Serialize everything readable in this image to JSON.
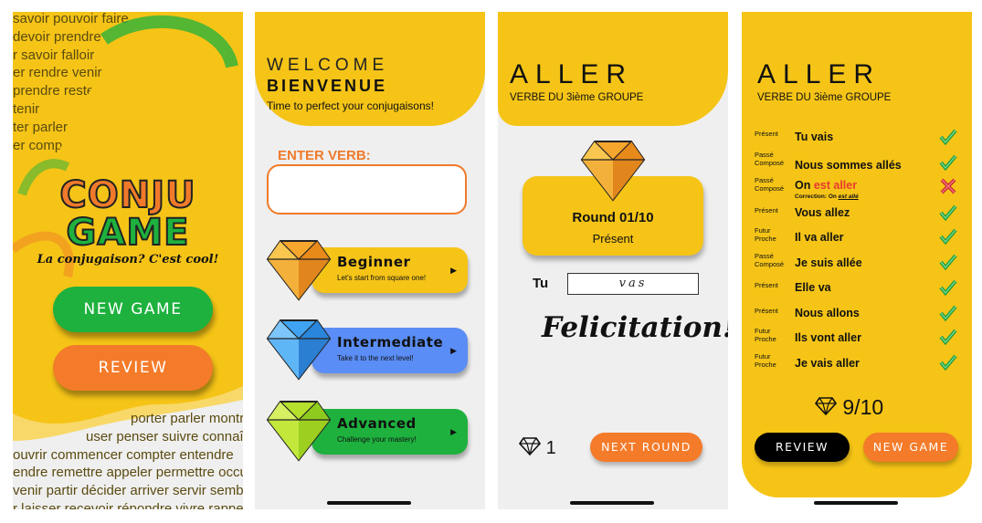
{
  "screen1": {
    "background_words": [
      "savoir pouvoir faire",
      "devoir prendre",
      "r savoir falloir",
      "er rendre venir",
      "prendre rester",
      "tenir",
      "ter parler mettre",
      "er comprendre",
      "porter parler montrer",
      "user penser suivre connaître",
      "ouvrir commencer compter entendre",
      "endre remettre appeler permettre occuper",
      "venir partir décider arriver servir sembler",
      "r laisser recevoir répondre vivre rappeler"
    ],
    "logo_line1": "CONJU",
    "logo_line2": "GAME",
    "tagline": "La conjugaison? C'est cool!",
    "new_game": "NEW GAME",
    "review": "REVIEW"
  },
  "screen2": {
    "welcome": "WELCOME",
    "bienvenue": "BIENVENUE",
    "subtitle": "Time to perfect your conjugaisons!",
    "enter_label": "ENTER VERB:",
    "verb_value": "",
    "levels": [
      {
        "title": "Beginner",
        "subtitle": "Let's start from square one!",
        "color": "#f5c417",
        "gem": "orange"
      },
      {
        "title": "Intermediate",
        "subtitle": "Take it to the next level!",
        "color": "#5a8df5",
        "gem": "blue"
      },
      {
        "title": "Advanced",
        "subtitle": "Challenge your mastery!",
        "color": "#1eb13e",
        "gem": "green"
      }
    ]
  },
  "screen3": {
    "verb": "ALLER",
    "group": "VERBE DU 3ième GROUPE",
    "round": "Round 01/10",
    "tense": "Présent",
    "pronoun": "Tu",
    "answer": "vas",
    "feedback": "Felicitation!",
    "score": "1",
    "next_round": "NEXT ROUND"
  },
  "screen4": {
    "verb": "ALLER",
    "group": "VERBE DU 3ième GROUPE",
    "results": [
      {
        "tense": "Présent",
        "phrase": "Tu vais",
        "correct": true
      },
      {
        "tense": "Passé Composé",
        "phrase": "Nous sommes allés",
        "correct": true
      },
      {
        "tense": "Passé Composé",
        "phrase_start": "On ",
        "phrase_error": "est aller",
        "correction_label": "Correction: On ",
        "correction_value": "est allé",
        "correct": false
      },
      {
        "tense": "Présent",
        "phrase": "Vous allez",
        "correct": true
      },
      {
        "tense": "Futur Proche",
        "phrase": "Il va aller",
        "correct": true
      },
      {
        "tense": "Passé Composé",
        "phrase": "Je suis allée",
        "correct": true
      },
      {
        "tense": "Présent",
        "phrase": "Elle va",
        "correct": true
      },
      {
        "tense": "Présent",
        "phrase": "Nous allons",
        "correct": true
      },
      {
        "tense": "Futur Proche",
        "phrase": "Ils vont aller",
        "correct": true
      },
      {
        "tense": "Futur Proche",
        "phrase": "Je vais aller",
        "correct": true
      }
    ],
    "final_score": "9/10",
    "review": "REVIEW",
    "new_game": "NEW GAME"
  },
  "colors": {
    "yellow": "#f5c417",
    "green": "#1eb13e",
    "orange": "#f47b29",
    "blue": "#5a8df5",
    "error_red": "#e63b2e"
  }
}
